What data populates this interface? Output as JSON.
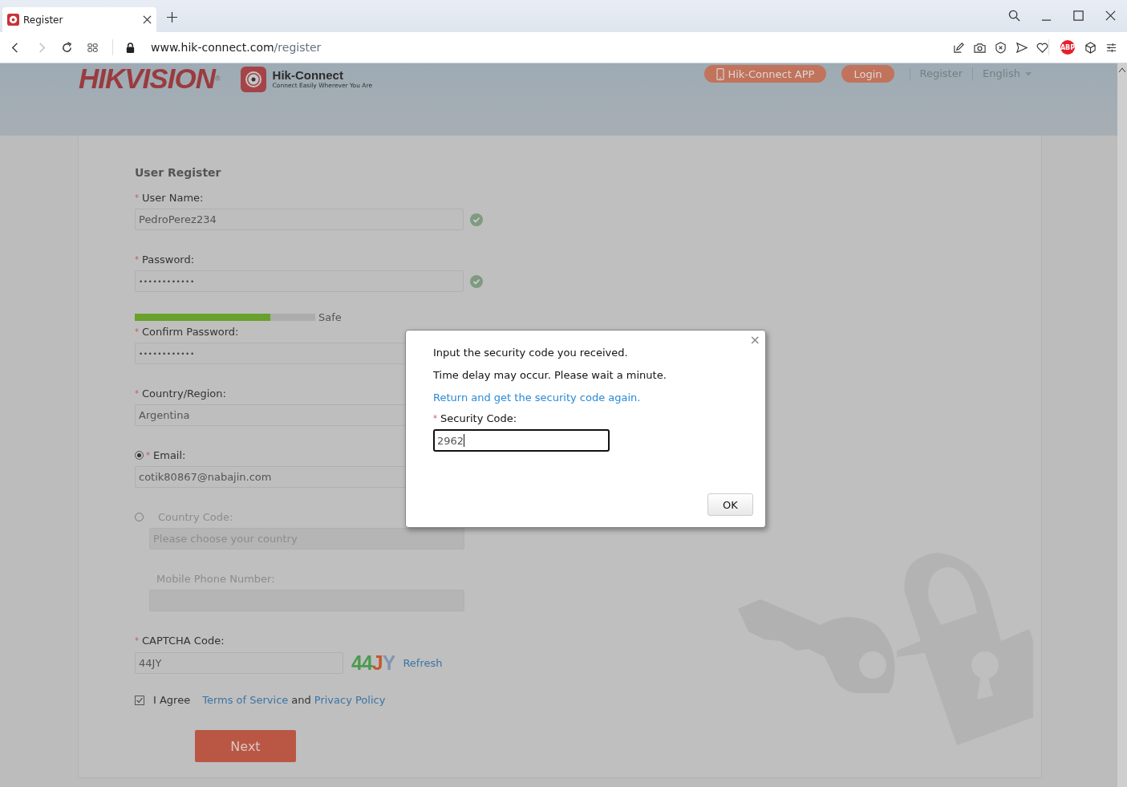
{
  "browser": {
    "tab_title": "Register",
    "url_host": "www.hik-connect.com",
    "url_path": "/register",
    "adblock_badge": "ABP"
  },
  "header": {
    "logo": "HIKVISION",
    "trademark": "®",
    "brand": "Hik-Connect",
    "tagline": "Connect Easily Wherever You Are",
    "nav": [
      {
        "kind": "pill",
        "label": "Hik-Connect APP",
        "icon": true
      },
      {
        "kind": "pill",
        "label": "Login",
        "icon": false
      },
      {
        "kind": "link",
        "label": "Register"
      },
      {
        "kind": "dropdown",
        "label": "English"
      }
    ]
  },
  "form": {
    "title": "User Register",
    "username": {
      "label": "User Name:",
      "required": "*",
      "value": "PedroPerez234",
      "valid": true
    },
    "password": {
      "label": "Password:",
      "required": "*",
      "value": "••••••••••••",
      "valid": true
    },
    "strength": {
      "level": 0.75,
      "label": "Safe"
    },
    "confirm": {
      "label": "Confirm Password:",
      "required": "*",
      "value": "••••••••••••"
    },
    "country": {
      "label": "Country/Region:",
      "required": "*",
      "value": "Argentina"
    },
    "contact_options": [
      {
        "kind": "email",
        "selected": true,
        "required": "*",
        "label": "Email:",
        "value": "cotik80867@nabajin.com"
      },
      {
        "kind": "phone",
        "selected": false,
        "label": "Country Code:",
        "placeholder": "Please choose your country",
        "sub_label": "Mobile Phone Number:"
      }
    ],
    "captcha": {
      "label": "CAPTCHA Code:",
      "required": "*",
      "value": "44JY",
      "image_text": "44JY",
      "refresh": "Refresh"
    },
    "agreement": {
      "checked": true,
      "label": "I Agree",
      "terms": "Terms of Service",
      "joiner": "and",
      "privacy": "Privacy Policy"
    },
    "next": "Next"
  },
  "dialog": {
    "close": "×",
    "message": "Input the security code you received.",
    "note": "Time delay may occur. Please wait a minute.",
    "link": "Return and get the security code again.",
    "field_label": "Security Code:",
    "required": "*",
    "value": "2962",
    "ok": "OK"
  }
}
